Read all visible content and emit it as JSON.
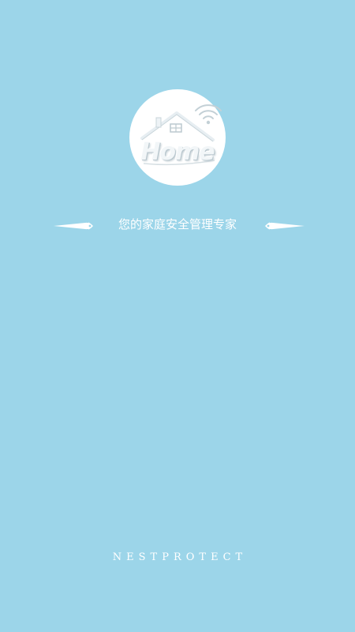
{
  "splash": {
    "logo": {
      "text": "Home",
      "icon": "house-wifi-icon"
    },
    "tagline": "您的家庭安全管理专家",
    "brand": "NESTPROTECT"
  },
  "colors": {
    "background": "#9CD5E9",
    "foreground": "#FFFFFF"
  }
}
